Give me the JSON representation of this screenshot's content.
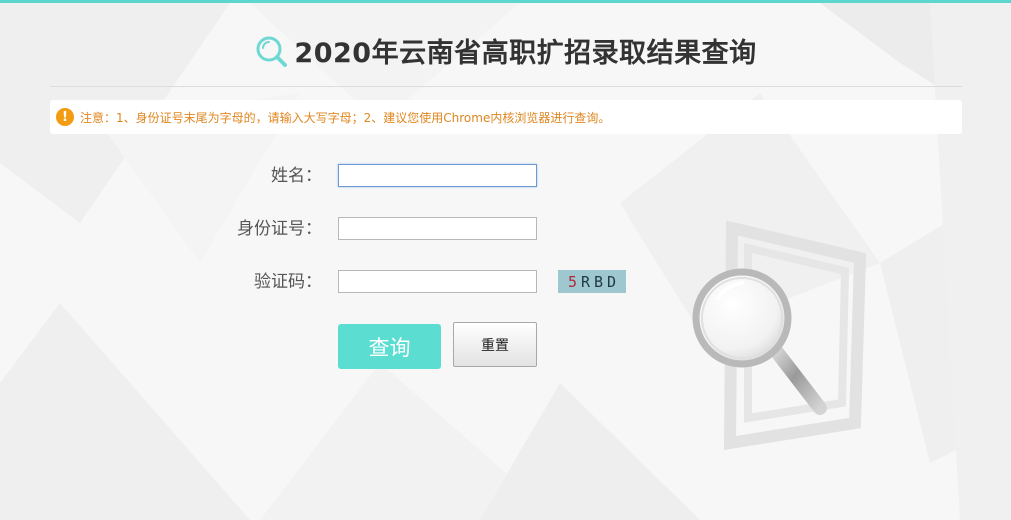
{
  "header": {
    "title": "2020年云南省高职扩招录取结果查询",
    "icon": "search-icon"
  },
  "notice": {
    "icon": "exclamation-icon",
    "text": "注意：1、身份证号末尾为字母的，请输入大写字母；2、建议您使用Chrome内核浏览器进行查询。"
  },
  "form": {
    "name_label": "姓名：",
    "name_value": "",
    "id_label": "身份证号：",
    "id_value": "",
    "captcha_label": "验证码：",
    "captcha_value": "",
    "captcha_image_first": "5",
    "captcha_image_rest": "RBD"
  },
  "buttons": {
    "query_label": "查询",
    "reset_label": "重置"
  },
  "colors": {
    "accent": "#5cd6cf",
    "notice_text": "#e0861f",
    "warning_icon": "#f39c12"
  }
}
